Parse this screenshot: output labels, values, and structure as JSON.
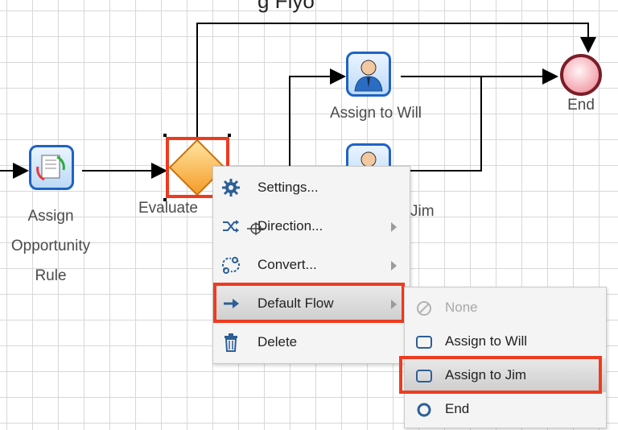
{
  "canvas": {
    "title_fragment": "g Flyo"
  },
  "nodes": {
    "assign_rule_label": [
      "Assign",
      "Opportunity",
      "Rule"
    ],
    "evaluate_label": "Evaluate",
    "assign_will_label": "Assign to Will",
    "assign_jim_label_fragment": "Jim",
    "end_label": "End"
  },
  "context_menu": {
    "items": [
      {
        "label": "Settings...",
        "icon": "gear-icon"
      },
      {
        "label": "Direction...",
        "icon": "shuffle-icon"
      },
      {
        "label": "Convert...",
        "icon": "convert-icon"
      },
      {
        "label": "Default Flow",
        "icon": "arrow-right-icon"
      },
      {
        "label": "Delete",
        "icon": "trash-icon"
      }
    ]
  },
  "submenu": {
    "items": [
      {
        "label": "None",
        "icon": "none-icon",
        "disabled": true
      },
      {
        "label": "Assign to Will",
        "icon": "task-icon"
      },
      {
        "label": "Assign to Jim",
        "icon": "task-icon"
      },
      {
        "label": "End",
        "icon": "end-circle-icon"
      }
    ]
  },
  "colors": {
    "highlight": "#ee3b20",
    "task_border": "#1e63c4",
    "gateway_fill": "#f7a232",
    "end_fill": "#f7b7bf"
  }
}
